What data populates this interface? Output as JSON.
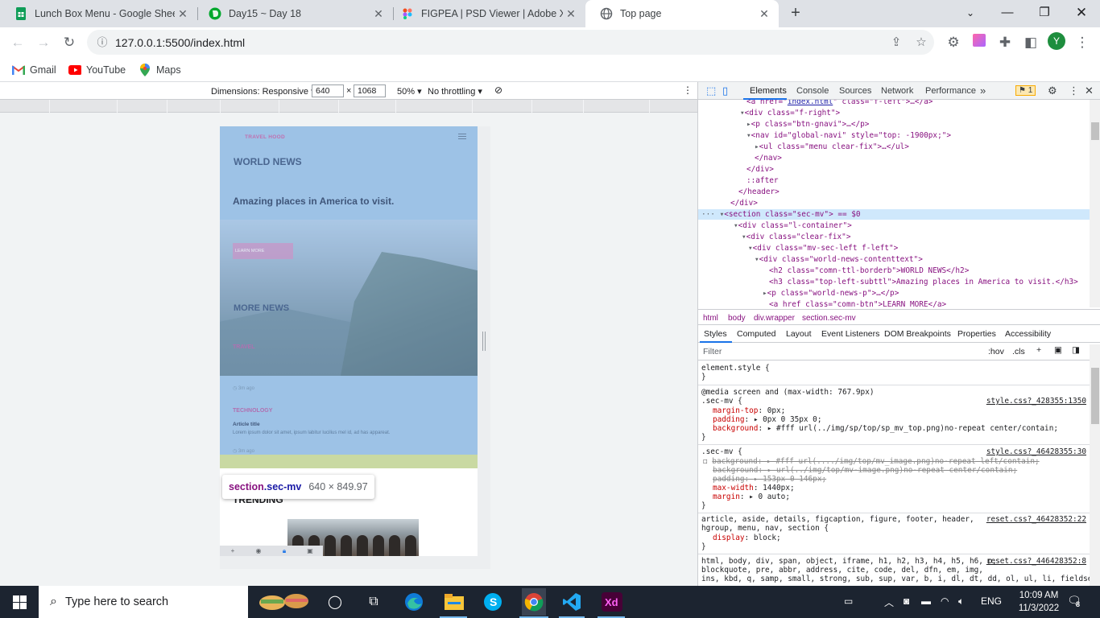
{
  "browser": {
    "tabs": [
      {
        "title": "Lunch Box Menu - Google Sheets",
        "icon": "google-sheets-icon",
        "color": "#0f9d58",
        "active": false
      },
      {
        "title": "Day15 ~ Day 18",
        "icon": "evernote-icon",
        "color": "#00a82d",
        "active": false
      },
      {
        "title": "FIGPEA | PSD Viewer | Adobe XD",
        "icon": "figpea-icon",
        "color": "#1a73e8",
        "active": false
      },
      {
        "title": "Top page",
        "icon": "globe-icon",
        "color": "#5f6368",
        "active": true
      }
    ],
    "url": "127.0.0.1:5500/index.html",
    "profile_initial": "Y",
    "bookmarks": [
      {
        "label": "Gmail",
        "icon": "gmail-icon"
      },
      {
        "label": "YouTube",
        "icon": "youtube-icon"
      },
      {
        "label": "Maps",
        "icon": "maps-icon"
      }
    ]
  },
  "device_toolbar": {
    "dimensions_label": "Dimensions: Responsive",
    "width": "640",
    "times": "×",
    "height": "1068",
    "zoom": "50%",
    "throttling": "No throttling"
  },
  "page": {
    "logo": "TRAVEL HOOD",
    "world_news": "WORLD NEWS",
    "subtitle": "Amazing places in America to visit.",
    "learn_more": "LEARN MORE",
    "more_news": "MORE NEWS",
    "categories": [
      "TRAVEL",
      "TECHNOLOGY"
    ],
    "time_ago": "3m ago",
    "article_title": "Article title",
    "article_text": "Lorem ipsum dolor sit amet, ipsum labitur lucilius mel id, ad has appareat.",
    "trending": "TRENDING"
  },
  "tooltip": {
    "selector_tag": "section",
    "selector_class": ".sec-mv",
    "size": "640 × 849.97"
  },
  "devtools": {
    "tabs": [
      "Elements",
      "Console",
      "Sources",
      "Network",
      "Performance"
    ],
    "issues_count": "1",
    "breadcrumbs": [
      "html",
      "body",
      "div.wrapper",
      "section.sec-mv"
    ],
    "style_tabs": [
      "Styles",
      "Computed",
      "Layout",
      "Event Listeners",
      "DOM Breakpoints",
      "Properties",
      "Accessibility"
    ],
    "filter_placeholder": "Filter",
    "hov": ":hov",
    "cls": ".cls",
    "elements_lines": [
      {
        "pre": "<a href=\"",
        "link": "index.html",
        "post": "\" class=\"f-left\">…</a>"
      },
      {
        "pre": "<div class=\"f-right\">"
      },
      {
        "pre": "<p class=\"btn-gnavi\">…</p>"
      },
      {
        "pre": "<nav id=\"global-navi\" style=\"top: -1900px;\">"
      },
      {
        "pre": "<ul class=\"menu clear-fix\">…</ul>"
      },
      {
        "pre": "</nav>"
      },
      {
        "pre": "</div>"
      },
      {
        "pre": "::after"
      },
      {
        "pre": "</header>"
      },
      {
        "pre": "</div>"
      },
      {
        "pre": "<section class=\"sec-mv\"> == $0"
      },
      {
        "pre": "<div class=\"l-container\">"
      },
      {
        "pre": "<div class=\"clear-fix\">"
      },
      {
        "pre": "<div class=\"mv-sec-left f-left\">"
      },
      {
        "pre": "<div class=\"world-news-contenttext\">"
      },
      {
        "pre": "<h2 class=\"comn-ttl-borderb\">WORLD NEWS</h2>"
      },
      {
        "pre": "<h3 class=\"top-left-subttl\">Amazing places in America to visit.</h3>"
      },
      {
        "pre": "<p class=\"world-news-p\">…</p>"
      },
      {
        "pre": "<a href class=\"comn-btn\">LEARN MORE</a>"
      }
    ],
    "styles": {
      "element_style": "element.style {",
      "close": "}",
      "media": "@media screen and (max-width: 767.9px)",
      "rule1_selector": ".sec-mv {",
      "rule1_source": "style.css?_428355:1350",
      "rule1_props": [
        {
          "name": "margin-top",
          "value": "0px;"
        },
        {
          "name": "padding",
          "value": "▸ 0px 0 35px 0;"
        },
        {
          "name": "background",
          "value": "▸ #fff url(../img/sp/top/sp_mv_top.png)no-repeat center/contain;"
        }
      ],
      "rule2_selector": ".sec-mv {",
      "rule2_source": "style.css?_46428355:30",
      "rule2_props": [
        {
          "name": "background",
          "value": "▸ #fff url(..../img/top/mv_image.png)no-repeat left/contain;",
          "struck": true
        },
        {
          "name": "background",
          "value": "▸ url(../img/top/mv-image.png)no-repeat center/contain;",
          "struck": true
        },
        {
          "name": "padding",
          "value": "▸ 153px 0 146px;",
          "struck": true
        },
        {
          "name": "max-width",
          "value": "1440px;"
        },
        {
          "name": "margin",
          "value": "▸ 0 auto;"
        }
      ],
      "rule3_selector_1": "article, aside, details, figcaption, figure, footer, header,",
      "rule3_selector_2": "hgroup, menu, nav, section {",
      "rule3_source": "reset.css?_46428352:22",
      "rule3_prop": {
        "name": "display",
        "value": "block;"
      },
      "rule4_selector_1": "html, body, div, span, object, iframe, h1, h2, h3, h4, h5, h6, p,",
      "rule4_selector_2": "blockquote, pre, abbr, address, cite, code, del, dfn, em, img,",
      "rule4_selector_3": "ins, kbd, q, samp, small, strong, sub, sup, var, b, i, dl, dt, dd, ol, ul, li, fieldset,",
      "rule4_source": "reset.css?_446428352:8"
    }
  },
  "taskbar": {
    "search_placeholder": "Type here to search",
    "language": "ENG",
    "time": "10:09 AM",
    "date": "11/3/2022",
    "notifications": "8"
  }
}
